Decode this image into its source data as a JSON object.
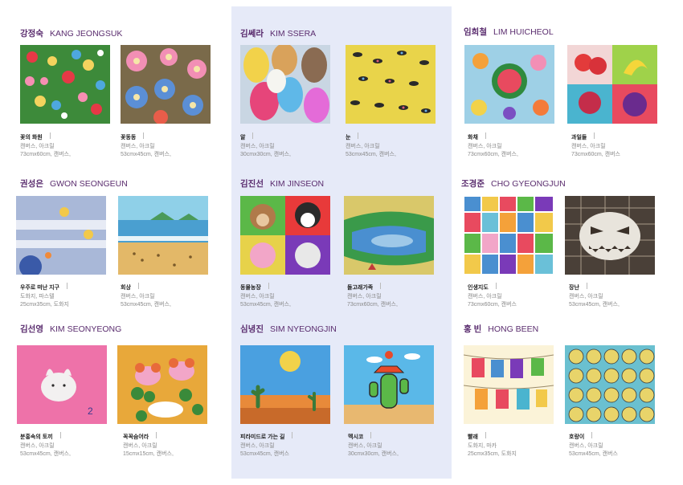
{
  "artists": [
    {
      "name_ko": "강정숙",
      "name_en": "KANG JEONGSUK",
      "works": [
        {
          "title": "꽃의 화원",
          "medium": "캔버스, 아크릴",
          "size": "73cmx60cm, 캔버스,"
        },
        {
          "title": "꽃동동",
          "medium": "캔버스, 아크릴",
          "size": "53cmx45cm, 캔버스,"
        }
      ]
    },
    {
      "name_ko": "김쎄라",
      "name_en": "KIM SSERA",
      "works": [
        {
          "title": "알",
          "medium": "캔버스, 아크릴",
          "size": "30cmx30cm, 캔버스,"
        },
        {
          "title": "눈",
          "medium": "캔버스, 아크릴",
          "size": "53cmx45cm, 캔버스,"
        }
      ]
    },
    {
      "name_ko": "임희철",
      "name_en": "LIM HUICHEOL",
      "works": [
        {
          "title": "화채",
          "medium": "캔버스, 아크릴",
          "size": "73cmx60cm, 캔버스,"
        },
        {
          "title": "과일들",
          "medium": "캔버스, 아크릴",
          "size": "73cmx60cm, 캔버스"
        }
      ]
    },
    {
      "name_ko": "권성은",
      "name_en": "GWON SEONGEUN",
      "works": [
        {
          "title": "우주로 떠난 지구",
          "medium": "도화지, 파스텔",
          "size": "25cmx35cm, 도화지"
        },
        {
          "title": "회상",
          "medium": "캔버스, 아크릴",
          "size": "53cmx45cm, 캔버스,"
        }
      ]
    },
    {
      "name_ko": "김진선",
      "name_en": "KIM JINSEON",
      "works": [
        {
          "title": "동물농장",
          "medium": "캔버스, 아크릴",
          "size": "53cmx45cm, 캔버스,"
        },
        {
          "title": "돌고래가족",
          "medium": "캔버스, 아크릴",
          "size": "73cmx60cm, 캔버스,"
        }
      ]
    },
    {
      "name_ko": "조경준",
      "name_en": "CHO GYEONGJUN",
      "works": [
        {
          "title": "인생지도",
          "medium": "캔버스, 아크릴",
          "size": "73cmx60cm, 캔버스"
        },
        {
          "title": "장난",
          "medium": "캔버스, 아크릴",
          "size": "53cmx45cm, 캔버스,"
        }
      ]
    },
    {
      "name_ko": "김선영",
      "name_en": "KIM SEONYEONG",
      "works": [
        {
          "title": "분홍속의 토끼",
          "medium": "캔버스, 아크릴",
          "size": "53cmx45cm, 캔버스,"
        },
        {
          "title": "꼭꼭숨어라",
          "medium": "캔버스, 아크릴",
          "size": "15cmx15cm, 캔버스,"
        }
      ]
    },
    {
      "name_ko": "심녕진",
      "name_en": "SIM NYEONGJIN",
      "works": [
        {
          "title": "피라미드로 가는 길",
          "medium": "캔버스, 아크릴",
          "size": "53cmx45cm, 캔버스"
        },
        {
          "title": "멕시코",
          "medium": "캔버스, 아크릴",
          "size": "30cmx30cm, 캔버스,"
        }
      ]
    },
    {
      "name_ko": "홍 빈",
      "name_en": "HONG BEEN",
      "works": [
        {
          "title": "빨래",
          "medium": "도화지, 마카",
          "size": "25cmx35cm, 도화지"
        },
        {
          "title": "호랑이",
          "medium": "캔버스, 아크릴",
          "size": "53cmx45cm, 캔버스"
        }
      ]
    }
  ]
}
